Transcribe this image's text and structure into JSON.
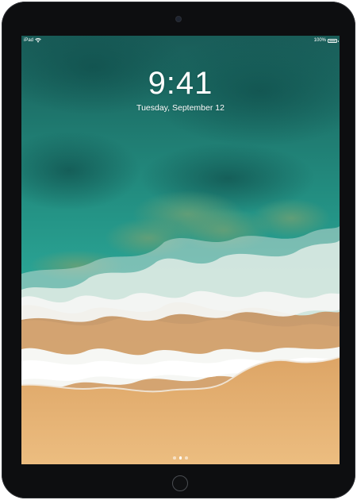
{
  "status_bar": {
    "device_label": "iPad",
    "wifi_icon": "wifi-icon",
    "battery_text": "100%",
    "battery_icon": "battery-full-icon"
  },
  "lock_screen": {
    "time": "9:41",
    "date": "Tuesday, September 12",
    "page_count": 3,
    "active_page": 2
  },
  "hardware": {
    "camera_icon": "front-camera-icon",
    "home_button_icon": "home-button-icon",
    "bezel_color": "#0d0e10"
  },
  "wallpaper": {
    "description_colors": {
      "ocean_deep": "#17645e",
      "ocean_teal": "#2aa295",
      "foam": "#f3f4f1",
      "sand": "#e4b070"
    }
  }
}
